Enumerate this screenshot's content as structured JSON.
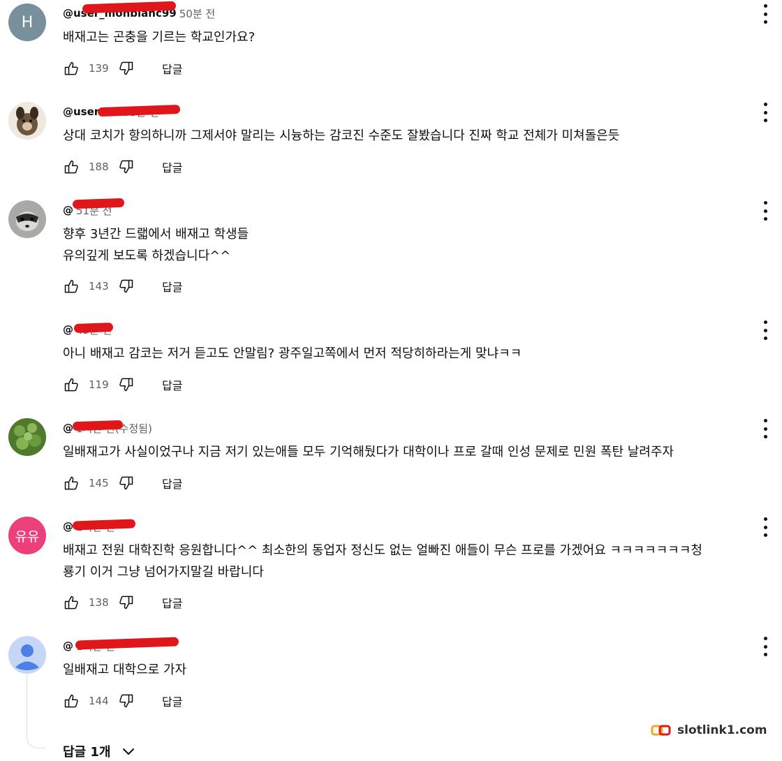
{
  "comments": [
    {
      "avatar_letter": "H",
      "avatar_color": "#78909c",
      "handle": "@user_monblanc99",
      "time": "50분 전",
      "text": [
        "배재고는 곤충을 기르는 학교인가요?"
      ],
      "likes": "139",
      "reply_label": "답글"
    },
    {
      "avatar_letter": "",
      "avatar_color": "#5a4a3c",
      "handle": "@user-ft5",
      "time": "55분 전",
      "text": [
        "상대 코치가 항의하니까 그제서야 말리는 시늉하는 감코진 수준도 잘봤습니다 진짜 학교 전체가 미쳐돌은듯"
      ],
      "likes": "188",
      "reply_label": "답글"
    },
    {
      "avatar_letter": "",
      "avatar_color": "#8a8a86",
      "handle": "@",
      "time": "51분 전",
      "text": [
        "향후 3년간 드랣에서 배재고 학생들",
        "유의깊게 보도록 하겠습니다^^"
      ],
      "likes": "143",
      "reply_label": "답글"
    },
    {
      "avatar_letter": "",
      "avatar_color": "#ffffff",
      "handle": "@",
      "time": "45분 전",
      "text": [
        "아니 배재고 감코는 저거 듣고도 안말림? 광주일고쪽에서 먼저 적당히하라는게 맞냐ㅋㅋ"
      ],
      "likes": "119",
      "reply_label": "답글"
    },
    {
      "avatar_letter": "",
      "avatar_color": "#5f8a3a",
      "handle": "@",
      "time": "1시간 전(수정됨)",
      "text": [
        "일배재고가 사실이었구나 지금 저기 있는애들 모두 기억해뒀다가 대학이나 프로 갈때 인성 문제로 민원 폭탄 날려주자"
      ],
      "likes": "145",
      "reply_label": "답글"
    },
    {
      "avatar_letter": "유유",
      "avatar_color": "#ec407a",
      "handle": "@",
      "time": "1시간 전",
      "text": [
        "배재고 전원 대학진학 응원합니다^^ 최소한의 동업자 정신도 없는 얼빠진 애들이 무슨 프로를 가겠어요 ㅋㅋㅋㅋㅋㅋㅋ청",
        "룡기 이거 그냥 넘어가지말길 바랍니다"
      ],
      "likes": "138",
      "reply_label": "답글"
    },
    {
      "avatar_letter": "",
      "avatar_color": "#c4d4f5",
      "handle": "@",
      "time": "1시간 전",
      "text": [
        "일배재고  대학으로 가자"
      ],
      "likes": "144",
      "reply_label": "답글"
    }
  ],
  "replies_label": "답글 1개",
  "watermark": "slotlink1.com",
  "colors": {
    "redaction": "#e0161b",
    "meta_text": "#606060",
    "text": "#0f0f0f"
  }
}
